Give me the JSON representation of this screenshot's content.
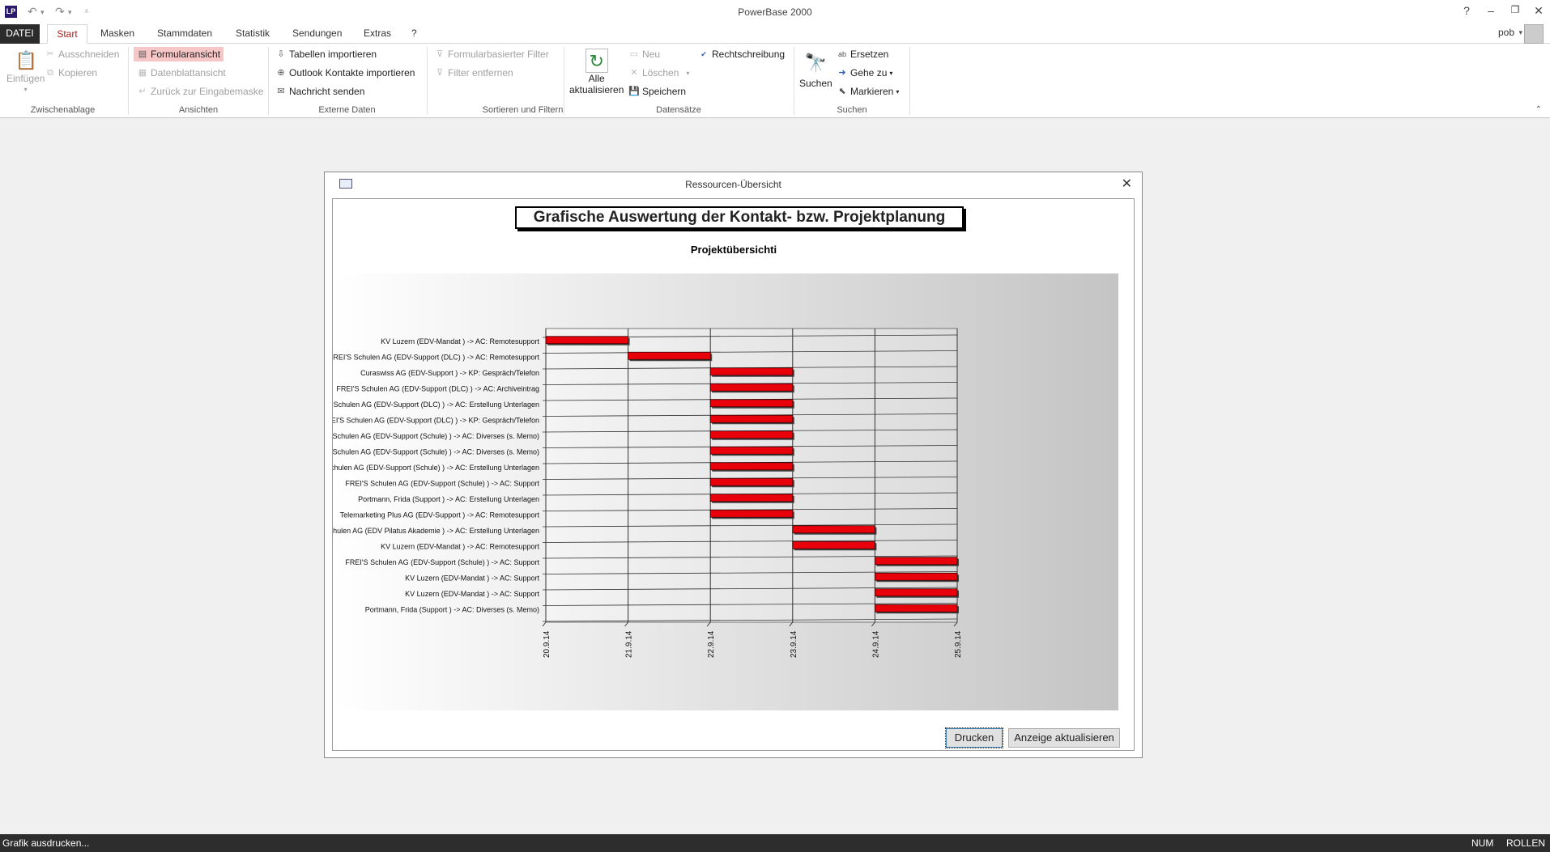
{
  "window": {
    "title": "PowerBase 2000",
    "app_icon": "LP",
    "help": "?",
    "user": "pob"
  },
  "tabs": [
    "DATEI",
    "Start",
    "Masken",
    "Stammdaten",
    "Statistik",
    "Sendungen",
    "Extras",
    "?"
  ],
  "ribbon": {
    "clipboard": {
      "paste": "Einfügen",
      "cut": "Ausschneiden",
      "copy": "Kopieren",
      "group": "Zwischenablage"
    },
    "views": {
      "form": "Formularansicht",
      "sheet": "Datenblattansicht",
      "back": "Zurück zur Eingabemaske",
      "group": "Ansichten"
    },
    "external": {
      "import_tables": "Tabellen importieren",
      "import_outlook": "Outlook Kontakte importieren",
      "send": "Nachricht senden",
      "group": "Externe Daten"
    },
    "sort": {
      "form_filter": "Formularbasierter Filter",
      "remove_filter": "Filter entfernen",
      "group": "Sortieren und Filtern"
    },
    "records": {
      "refresh_line1": "Alle",
      "refresh_line2": "aktualisieren",
      "new": "Neu",
      "delete": "Löschen",
      "save": "Speichern",
      "spell": "Rechtschreibung",
      "group": "Datensätze"
    },
    "search": {
      "find": "Suchen",
      "replace": "Ersetzen",
      "goto": "Gehe zu",
      "select": "Markieren",
      "group": "Suchen"
    }
  },
  "dialog": {
    "title": "Ressourcen-Übersicht",
    "heading": "Grafische Auswertung der Kontakt- bzw. Projektplanung",
    "print": "Drucken",
    "refresh": "Anzeige aktualisieren"
  },
  "status": {
    "text": "Grafik ausdrucken...",
    "num": "NUM",
    "scroll": "ROLLEN"
  },
  "colors": {
    "bar": "#e8000a",
    "accent": "#b01c1c"
  },
  "chart_data": {
    "type": "bar",
    "orientation": "horizontal-gantt",
    "title": "Projektübersichti",
    "x_ticks": [
      "20.9.14",
      "21.9.14",
      "22.9.14",
      "23.9.14",
      "24.9.14",
      "25.9.14"
    ],
    "categories": [
      "KV Luzern (EDV-Mandat ) -> AC: Remotesupport",
      "FREI'S Schulen AG (EDV-Support (DLC) ) -> AC: Remotesupport",
      "Curaswiss AG (EDV-Support ) -> KP: Gespräch/Telefon",
      "FREI'S Schulen AG (EDV-Support (DLC) ) -> AC: Archiveintrag",
      "FREI'S Schulen AG (EDV-Support (DLC) ) -> AC: Erstellung Unterlagen",
      "FREI'S Schulen AG (EDV-Support (DLC) ) -> KP: Gespräch/Telefon",
      "FREI'S Schulen AG (EDV-Support (Schule) ) -> AC: Diverses (s. Memo)",
      "FREI'S Schulen AG (EDV-Support (Schule) ) -> AC: Diverses (s. Memo)",
      "FREI'S Schulen AG (EDV-Support (Schule) ) -> AC: Erstellung Unterlagen",
      "FREI'S Schulen AG (EDV-Support (Schule) ) -> AC: Support",
      "Portmann, Frida (Support ) -> AC: Erstellung Unterlagen",
      "Telemarketing Plus AG (EDV-Support ) -> AC: Remotesupport",
      "FREI'S Schulen AG (EDV Pilatus Akademie ) -> AC: Erstellung Unterlagen",
      "KV Luzern (EDV-Mandat ) -> AC: Remotesupport",
      "FREI'S Schulen AG (EDV-Support (Schule) ) -> AC: Support",
      "KV Luzern (EDV-Mandat ) -> AC: Support",
      "KV Luzern (EDV-Mandat ) -> AC: Support",
      "Portmann, Frida (Support ) -> AC: Diverses (s. Memo)"
    ],
    "start": [
      "20.9.14",
      "21.9.14",
      "22.9.14",
      "22.9.14",
      "22.9.14",
      "22.9.14",
      "22.9.14",
      "22.9.14",
      "22.9.14",
      "22.9.14",
      "22.9.14",
      "22.9.14",
      "23.9.14",
      "23.9.14",
      "24.9.14",
      "24.9.14",
      "24.9.14",
      "24.9.14"
    ],
    "end": [
      "21.9.14",
      "22.9.14",
      "23.9.14",
      "23.9.14",
      "23.9.14",
      "23.9.14",
      "23.9.14",
      "23.9.14",
      "23.9.14",
      "23.9.14",
      "23.9.14",
      "23.9.14",
      "24.9.14",
      "24.9.14",
      "25.9.14",
      "25.9.14",
      "25.9.14",
      "25.9.14"
    ],
    "grid": true,
    "legend": "none"
  }
}
